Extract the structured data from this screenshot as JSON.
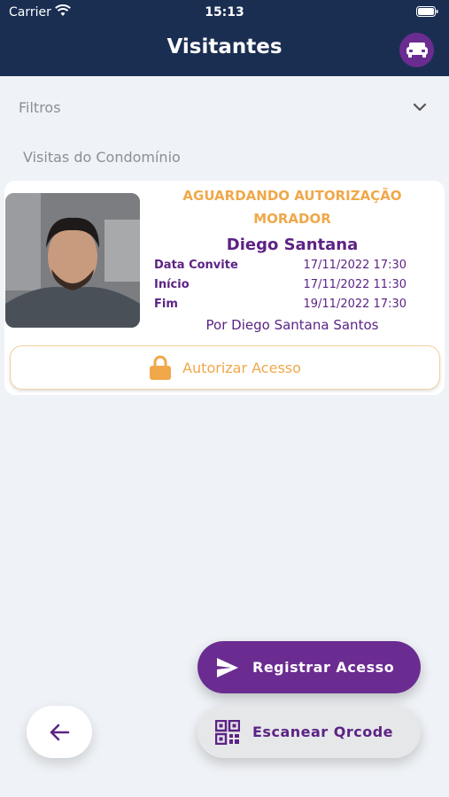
{
  "status_bar": {
    "carrier": "Carrier",
    "time": "15:13"
  },
  "header": {
    "title": "Visitantes"
  },
  "filters": {
    "label": "Filtros"
  },
  "section": {
    "title": "Visitas do Condomínio"
  },
  "visit_card": {
    "status": "AGUARDANDO AUTORIZAÇÃO MORADOR",
    "visitor_name": "Diego Santana",
    "fields": [
      {
        "label": "Data Convite",
        "value": "17/11/2022 17:30"
      },
      {
        "label": "Início",
        "value": "17/11/2022 11:30"
      },
      {
        "label": "Fim",
        "value": "19/11/2022 17:30"
      }
    ],
    "created_by": "Por Diego Santana Santos",
    "authorize_label": "Autorizar Acesso"
  },
  "actions": {
    "register_label": "Registrar Acesso",
    "scan_label": "Escanear Qrcode"
  },
  "colors": {
    "header_bg": "#1a2e52",
    "brand_purple": "#6b2c91",
    "status_orange": "#f0a84a",
    "background": "#eff2f6"
  },
  "icons": {
    "wifi": "wifi-icon",
    "battery": "battery-icon",
    "avatar": "car-icon",
    "chevron": "chevron-down-icon",
    "lock": "lock-icon",
    "send": "send-icon",
    "qrcode": "qrcode-icon",
    "back": "arrow-left-icon"
  }
}
